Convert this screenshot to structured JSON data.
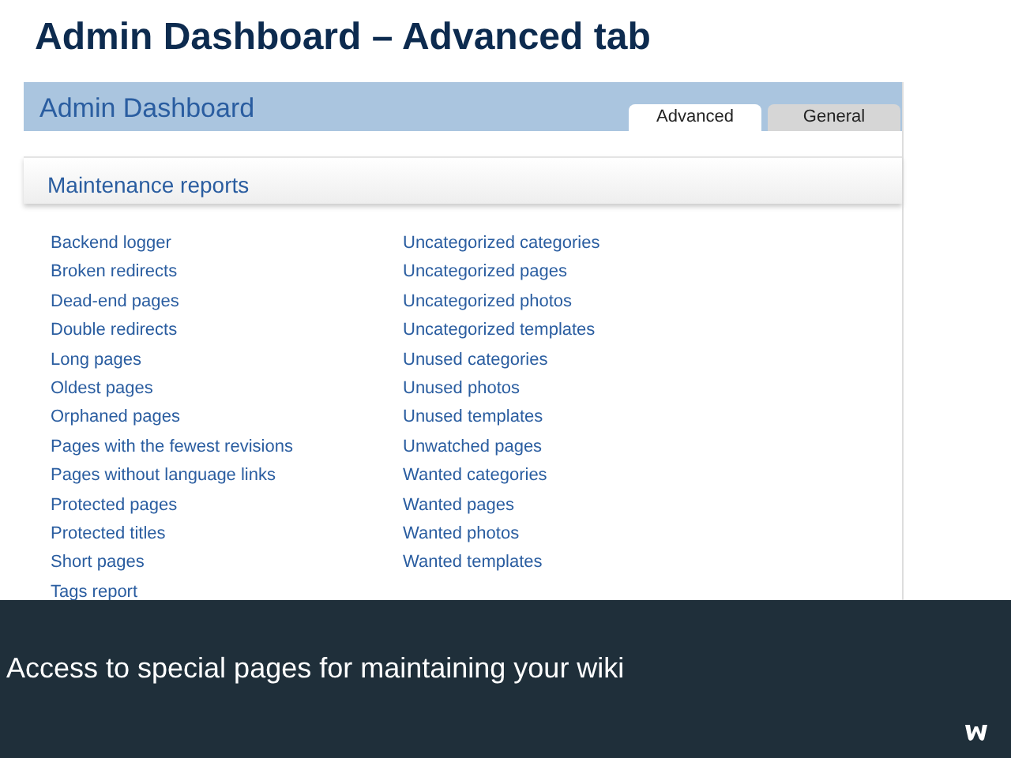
{
  "slide_title": "Admin Dashboard – Advanced tab",
  "dashboard": {
    "title": "Admin Dashboard",
    "tabs": [
      {
        "label": "Advanced",
        "selected": true
      },
      {
        "label": "General",
        "selected": false
      }
    ],
    "section": "Maintenance reports",
    "columns": [
      [
        "Backend logger",
        "Broken redirects",
        "Dead-end pages",
        "Double redirects",
        "Long pages",
        "Oldest pages",
        "Orphaned pages",
        "Pages with the fewest revisions",
        "Pages without language links",
        "Protected pages",
        "Protected titles",
        "Short pages",
        "Tags report"
      ],
      [
        "Uncategorized categories",
        "Uncategorized pages",
        "Uncategorized photos",
        "Uncategorized templates",
        "Unused categories",
        "Unused photos",
        "Unused templates",
        "Unwatched pages",
        "Wanted categories",
        "Wanted pages",
        "Wanted photos",
        "Wanted templates"
      ]
    ]
  },
  "caption": "Access to special pages for maintaining your wiki"
}
